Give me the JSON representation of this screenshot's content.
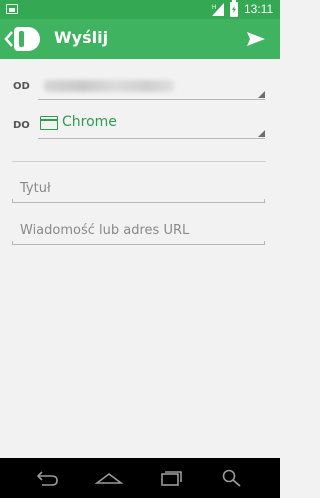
{
  "status_bar": {
    "time": "13:11",
    "notification_icon": "image-icon",
    "signal_icon": "signal-icon",
    "battery_icon": "battery-charging-icon"
  },
  "app_bar": {
    "title": "Wyślij",
    "back_icon": "chevron-left-icon",
    "logo_icon": "app-logo-icon",
    "send_icon": "send-icon",
    "color": "#3fb35f"
  },
  "form": {
    "from_label": "OD",
    "to_label": "DO",
    "to_value": "Chrome",
    "to_value_color": "#2f9c4f",
    "title_placeholder": "Tytuł",
    "message_placeholder": "Wiadomość lub adres URL"
  },
  "nav_bar": {
    "back_icon": "back-icon",
    "home_icon": "home-icon",
    "recents_icon": "recents-icon",
    "search_icon": "search-icon"
  }
}
